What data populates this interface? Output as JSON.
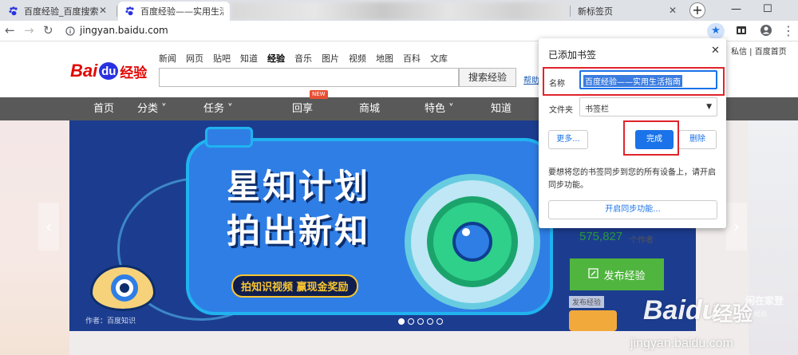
{
  "browser": {
    "tabs": [
      {
        "title": "百度经验_百度搜索"
      },
      {
        "title": "百度经验——实用生活指"
      },
      {
        "title": "新标签页"
      }
    ],
    "url": "jingyan.baidu.com",
    "window_controls": {
      "minimize": "—",
      "maximize": "☐"
    }
  },
  "page": {
    "logo": {
      "bai": "Bai",
      "du": "du",
      "jingyan": "经验"
    },
    "category_links": [
      "新闻",
      "网页",
      "贴吧",
      "知道",
      "经验",
      "音乐",
      "图片",
      "视频",
      "地图",
      "百科",
      "文库"
    ],
    "active_category": "经验",
    "search": {
      "button_label": "搜索经验",
      "help_link": "帮助"
    },
    "top_links": "私信 | 百度首页",
    "main_nav": [
      {
        "label": "首页"
      },
      {
        "label": "分类 ˅"
      },
      {
        "label": "任务 ˅"
      },
      {
        "label": "回享"
      },
      {
        "label": "商城"
      },
      {
        "label": "特色 ˅"
      },
      {
        "label": "知道"
      }
    ],
    "new_badge": "NEW",
    "banner": {
      "title_line1": "星知计划",
      "title_line2": "拍出新知",
      "slogan": "拍知识视频 赢现金奖励",
      "author": "作者：百度知识"
    },
    "stats": {
      "count": "575,827",
      "unit": "个作者"
    },
    "publish_button": "发布经验",
    "publish_small": "发布经验"
  },
  "bookmark_popup": {
    "title": "已添加书签",
    "name_label": "名称",
    "name_value": "百度经验——实用生活指南",
    "folder_label": "文件夹",
    "folder_value": "书签栏",
    "more_button": "更多...",
    "done_button": "完成",
    "delete_button": "删除",
    "sync_text": "要想将您的书签同步到您的所有设备上，请开启同步功能。",
    "sync_button": "开启同步功能..."
  },
  "watermark": {
    "baidu": "Baidu",
    "jingyan": "经验",
    "url": "jingyan.baidu.com",
    "corner": "闲在家登",
    "corner_sub": "经验"
  },
  "colors": {
    "accent": "#1a73e8",
    "highlight": "#e0242c",
    "nav_bg": "#595959",
    "publish_green": "#4fb53e"
  }
}
